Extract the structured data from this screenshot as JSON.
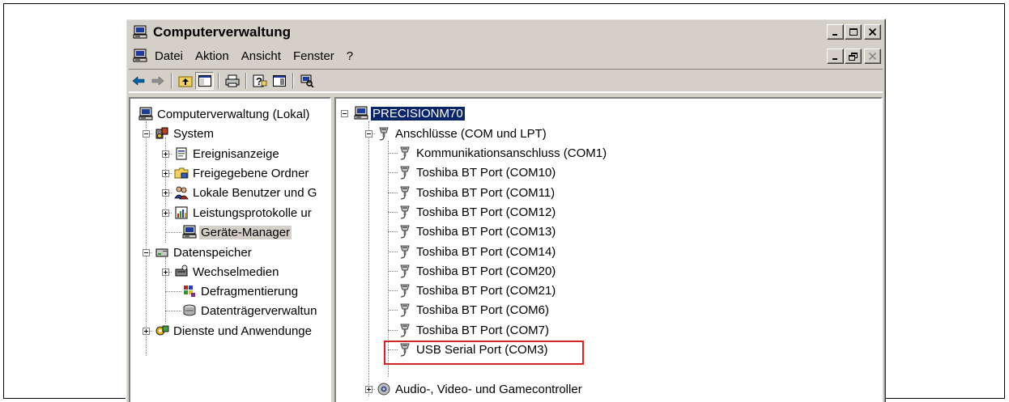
{
  "window": {
    "title": "Computerverwaltung",
    "colors": {
      "chrome": "#d4d0c8",
      "selection": "#0a246a",
      "highlight_border": "#e02020"
    }
  },
  "menubar": {
    "items": [
      "Datei",
      "Aktion",
      "Ansicht",
      "Fenster",
      "?"
    ]
  },
  "toolbar": {
    "buttons": [
      "back-icon",
      "forward-icon",
      "up-folder-icon",
      "show-hide-tree-icon",
      "print-icon",
      "help-icon",
      "properties-icon",
      "scan-hardware-icon"
    ]
  },
  "left_tree": {
    "root": "Computerverwaltung (Lokal)",
    "system": "System",
    "ereignisanzeige": "Ereignisanzeige",
    "freigegebene_ordner": "Freigegebene Ordner",
    "lokale_benutzer": "Lokale Benutzer und G",
    "leistungsprotokolle": "Leistungsprotokolle ur",
    "geraete_manager": "Geräte-Manager",
    "datenspeicher": "Datenspeicher",
    "wechselmedien": "Wechselmedien",
    "defragmentierung": "Defragmentierung",
    "datentraegerverwaltung": "Datenträgerverwaltun",
    "dienste": "Dienste und Anwendunge"
  },
  "right_tree": {
    "computer": "PRECISIONM70",
    "ports_category": "Anschlüsse (COM und LPT)",
    "ports": [
      "Kommunikationsanschluss (COM1)",
      "Toshiba BT Port (COM10)",
      "Toshiba BT Port (COM11)",
      "Toshiba BT Port (COM12)",
      "Toshiba BT Port (COM13)",
      "Toshiba BT Port (COM14)",
      "Toshiba BT Port (COM20)",
      "Toshiba BT Port (COM21)",
      "Toshiba BT Port (COM6)",
      "Toshiba BT Port (COM7)",
      "USB Serial Port (COM3)"
    ],
    "audio_category": "Audio-, Video- und Gamecontroller"
  }
}
